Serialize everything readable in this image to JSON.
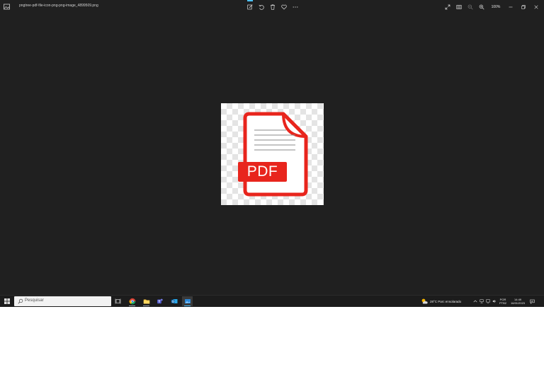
{
  "window": {
    "title": "pngtree-pdf-file-icon-png-png-image_4899509.png",
    "zoom": "100%"
  },
  "image": {
    "pdf_text": "PDF",
    "colors": {
      "red": "#e8251d",
      "background": "#202020"
    }
  },
  "taskbar": {
    "search_placeholder": "Pesquisar",
    "weather": "28°C  Parc ensolarado",
    "language": "POR",
    "layout": "PTB2",
    "time": "14:49",
    "date": "16/01/2023"
  }
}
